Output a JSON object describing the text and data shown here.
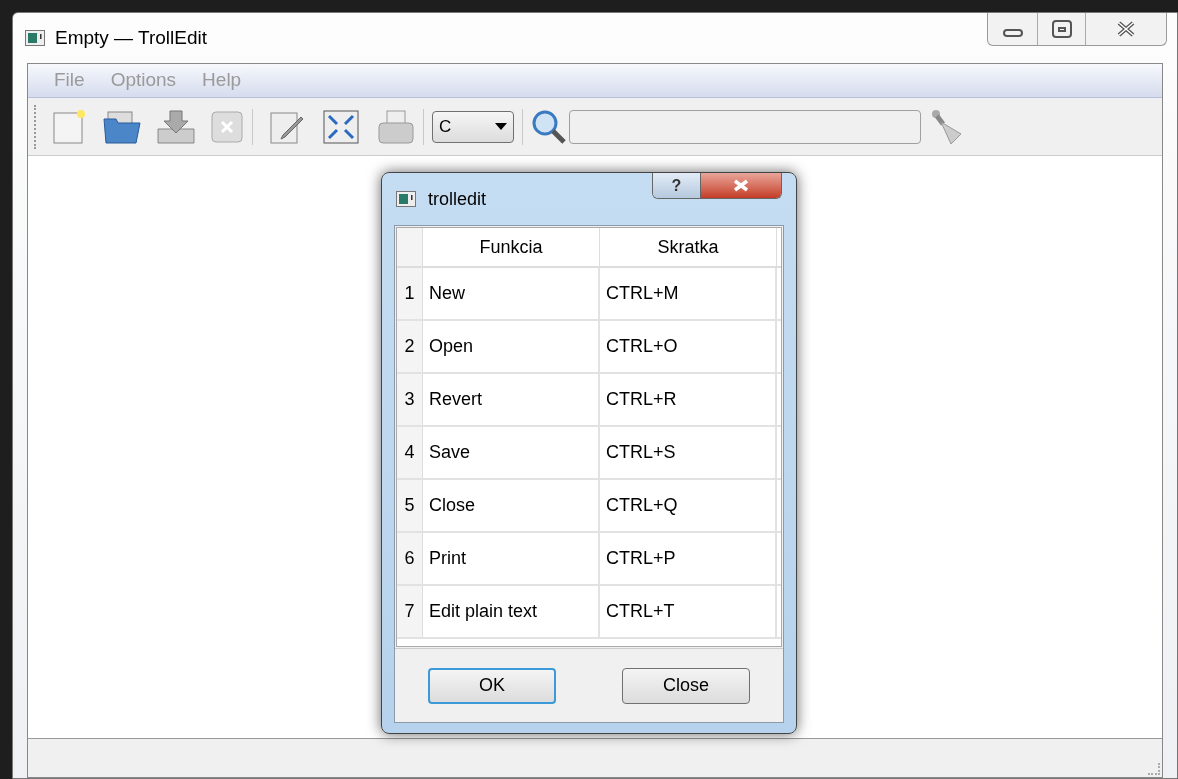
{
  "window": {
    "title": "Empty — TrollEdit"
  },
  "menu": [
    {
      "label": "File",
      "disabled": true
    },
    {
      "label": "Options",
      "disabled": true
    },
    {
      "label": "Help",
      "disabled": true
    }
  ],
  "toolbar": {
    "language": "C"
  },
  "dialog": {
    "title": "trolledit",
    "help_button": "?",
    "table": {
      "columns": [
        "Funkcia",
        "Skratka"
      ],
      "rows": [
        {
          "index": "1",
          "cells": [
            "New",
            "CTRL+M"
          ]
        },
        {
          "index": "2",
          "cells": [
            "Open",
            "CTRL+O"
          ]
        },
        {
          "index": "3",
          "cells": [
            "Revert",
            "CTRL+R"
          ]
        },
        {
          "index": "4",
          "cells": [
            "Save",
            "CTRL+S"
          ]
        },
        {
          "index": "5",
          "cells": [
            "Close",
            "CTRL+Q"
          ]
        },
        {
          "index": "6",
          "cells": [
            "Print",
            "CTRL+P"
          ]
        },
        {
          "index": "7",
          "cells": [
            "Edit plain text",
            "CTRL+T"
          ]
        }
      ]
    },
    "buttons": [
      {
        "label": "OK",
        "default": true
      },
      {
        "label": "Close",
        "default": false
      }
    ]
  }
}
